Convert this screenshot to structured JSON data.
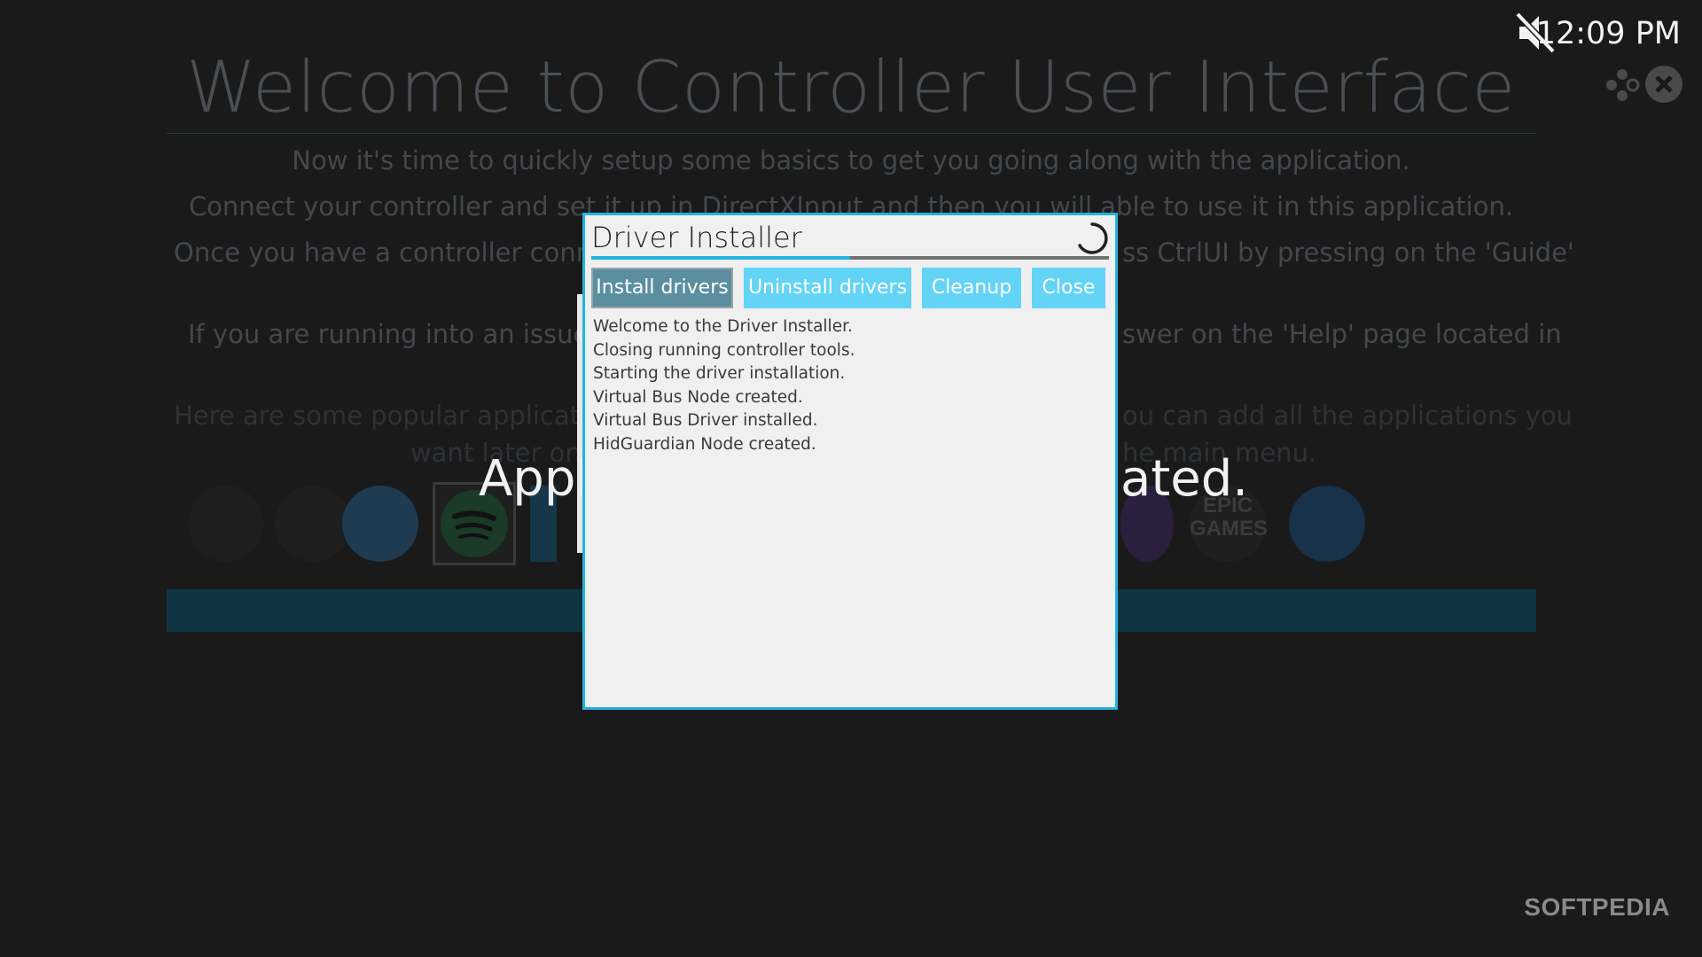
{
  "status_bar": {
    "clock": "12:09 PM",
    "mute_icon": "speaker-muted-icon",
    "controller_icon": "gamepad-icon",
    "close_icon": "close-icon"
  },
  "background": {
    "title": "Welcome to Controller User Interface",
    "lines": [
      "Now it's time to quickly setup some basics to get you going along with the application.",
      "Connect your controller and set it up in DirectXInput and then you will able to use it in this application.",
      "Once you have a controller connec",
      "ss CtrlUI by pressing on the 'Guide'",
      "If you are running into an issue o",
      "swer on the 'Help' page located in",
      "Here are some popular applicatio",
      "ou can add all the applications you",
      "want later on",
      "he main menu."
    ],
    "overlay_left": "Appl",
    "overlay_right": "ated.",
    "epic_logo": "EPIC GAMES"
  },
  "dialog": {
    "title": "Driver Installer",
    "progress": 0.5,
    "buttons": {
      "install": "Install drivers",
      "uninstall": "Uninstall drivers",
      "cleanup": "Cleanup",
      "close": "Close"
    },
    "log": [
      "Welcome to the Driver Installer.",
      "Closing running controller tools.",
      "Starting the driver installation.",
      "Virtual Bus Node created.",
      "Virtual Bus Driver installed.",
      "HidGuardian Node created."
    ]
  },
  "watermark": "SOFTPEDIA",
  "colors": {
    "accent": "#21b4e0",
    "button": "#63d4f5",
    "button_active": "#5b8fa0",
    "background": "#1a1a1a"
  }
}
